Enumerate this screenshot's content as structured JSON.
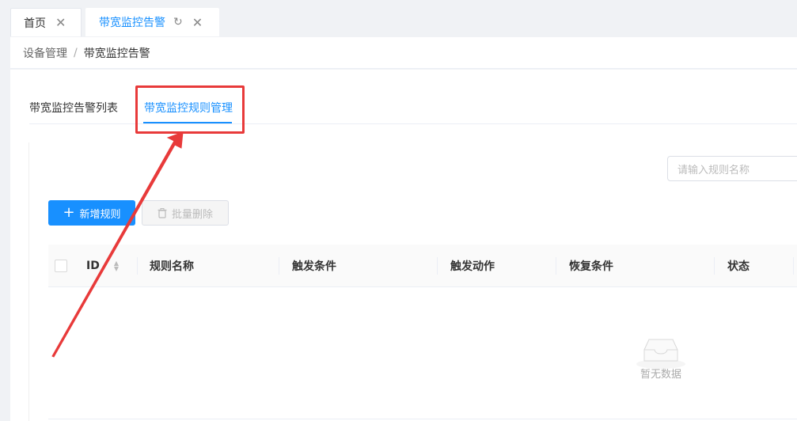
{
  "tabs": {
    "home": "首页",
    "active": "带宽监控告警"
  },
  "breadcrumb": {
    "parent": "设备管理",
    "separator": "/",
    "current": "带宽监控告警"
  },
  "subtabs": {
    "list": "带宽监控告警列表",
    "rules": "带宽监控规则管理"
  },
  "search": {
    "placeholder": "请输入规则名称"
  },
  "toolbar": {
    "add_label": "新增规则",
    "delete_label": "批量删除"
  },
  "table": {
    "columns": [
      "ID",
      "规则名称",
      "触发条件",
      "触发动作",
      "恢复条件",
      "状态"
    ]
  },
  "empty": {
    "text": "暂无数据"
  },
  "colors": {
    "primary": "#1890ff",
    "annotation": "#e83a3a"
  }
}
